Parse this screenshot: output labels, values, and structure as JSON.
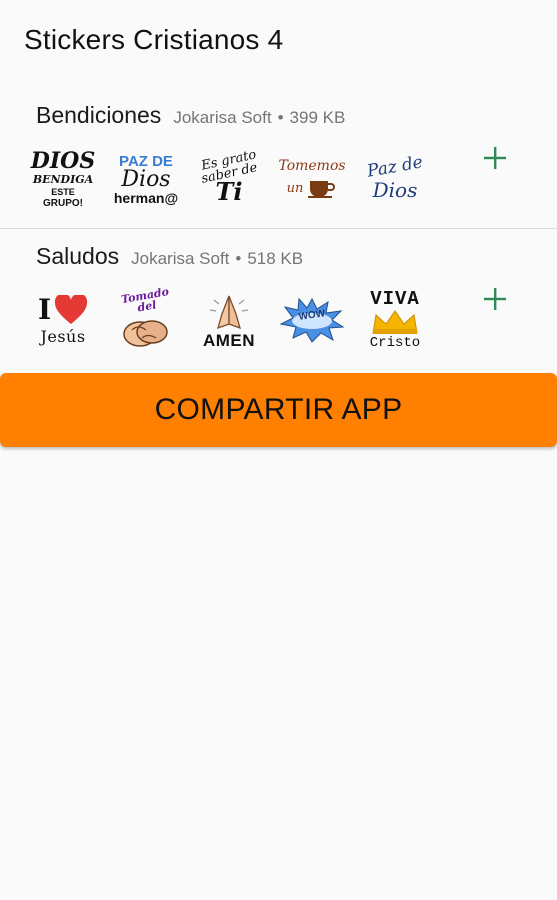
{
  "app": {
    "title": "Stickers Cristianos 4"
  },
  "packs": [
    {
      "name": "Bendiciones",
      "publisher": "Jokarisa Soft",
      "size": "399 KB",
      "stickers": [
        {
          "icon": "dios-bendiga-sticker",
          "lines": [
            "DIOS",
            "BENDIGA",
            "ESTE",
            "GRUPO!"
          ]
        },
        {
          "icon": "paz-de-dios-hermano-sticker",
          "lines": [
            "PAZ DE",
            "Dios",
            "herman@"
          ]
        },
        {
          "icon": "es-grato-saber-de-ti-sticker",
          "lines": [
            "Es grato",
            "saber de",
            "Ti"
          ]
        },
        {
          "icon": "tomemos-un-cafe-sticker",
          "lines": [
            "Tomemos",
            "un"
          ]
        },
        {
          "icon": "paz-de-dios-script-sticker",
          "lines": [
            "Paz de",
            "Dios"
          ]
        }
      ]
    },
    {
      "name": "Saludos",
      "publisher": "Jokarisa Soft",
      "size": "518 KB",
      "stickers": [
        {
          "icon": "i-love-jesus-sticker",
          "lines": [
            "I",
            "Jesús"
          ]
        },
        {
          "icon": "tomado-del-brazo-sticker",
          "lines": [
            "Tomado del",
            "brazo"
          ]
        },
        {
          "icon": "amen-praying-hands-sticker",
          "lines": [
            "AMEN"
          ]
        },
        {
          "icon": "starburst-sticker",
          "lines": [
            "WOW"
          ]
        },
        {
          "icon": "viva-cristo-crown-sticker",
          "lines": [
            "VIVA",
            "Cristo"
          ]
        }
      ]
    }
  ],
  "actions": {
    "add_icon": "plus-icon",
    "share_label": "COMPARTIR APP"
  },
  "colors": {
    "accent_orange": "#ff7f00",
    "add_green": "#2e8b57",
    "background": "#fafafa",
    "divider": "#dcdcdc"
  }
}
